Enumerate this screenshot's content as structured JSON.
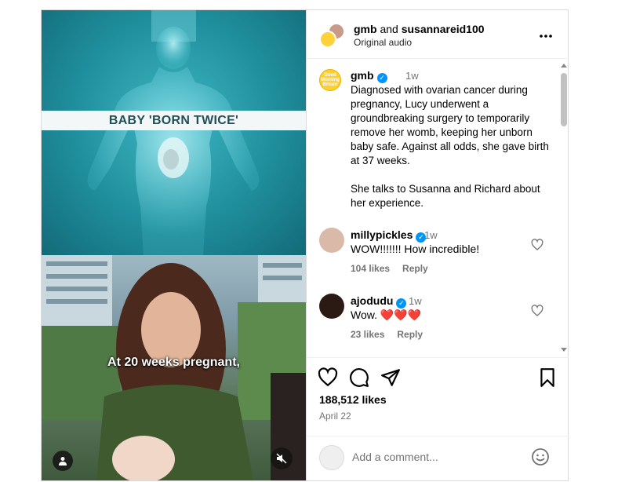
{
  "header": {
    "user1": "gmb",
    "joiner": "and",
    "user2": "susannareid100",
    "audio": "Original audio",
    "more_icon": "more-horizontal-icon"
  },
  "media": {
    "banner": "BABY 'BORN TWICE'",
    "caption": "At 20 weeks pregnant,"
  },
  "caption_post": {
    "username": "gmb",
    "time": "1w",
    "avatar_text": "Good Morning Britain",
    "text": "Diagnosed with ovarian cancer during pregnancy, Lucy underwent a groundbreaking surgery to temporarily remove her womb, keeping her unborn baby safe. Against all odds, she gave birth at 37 weeks.\n\nShe talks to Susanna and Richard about her experience."
  },
  "comments": [
    {
      "username": "millypickles",
      "time": "1w",
      "text": "WOW!!!!!!! How incredible!",
      "likes": "104 likes",
      "reply": "Reply"
    },
    {
      "username": "ajodudu",
      "time": "1w",
      "text": "Wow. ❤️❤️❤️",
      "likes": "23 likes",
      "reply": "Reply"
    }
  ],
  "actions": {
    "likes": "188,512 likes",
    "date": "April 22"
  },
  "add_comment": {
    "placeholder": "Add a comment..."
  },
  "colors": {
    "verified": "#0095f6",
    "border": "#dbdbdb",
    "muted_text": "#737373"
  }
}
